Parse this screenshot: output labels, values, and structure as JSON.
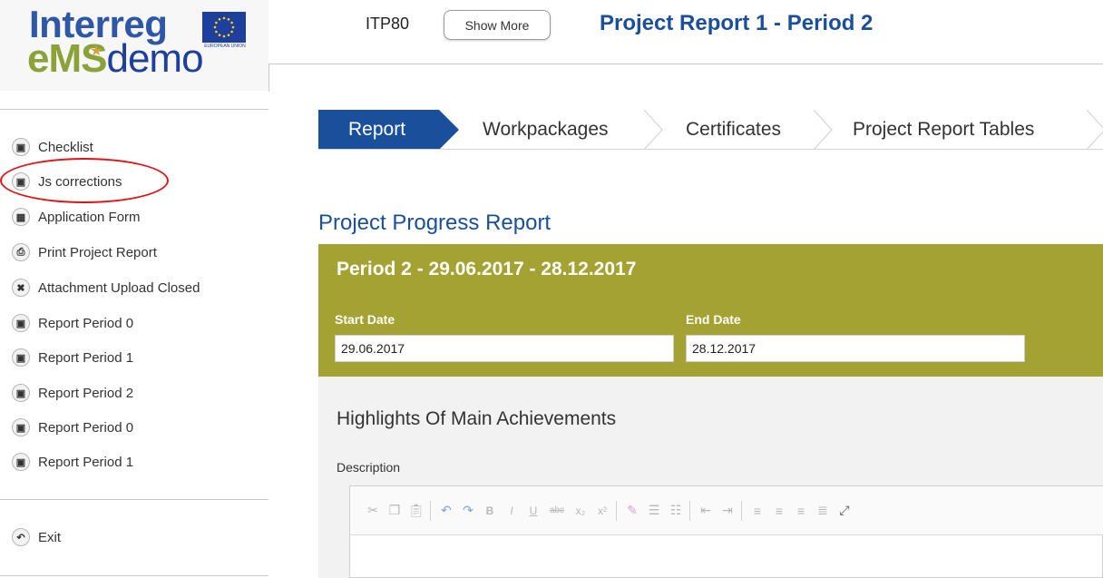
{
  "logo": {
    "line1": "Interreg",
    "line2_ems": "eMS",
    "line2_demo": "demo",
    "eu_caption": "EUROPEAN UNION"
  },
  "header": {
    "project_code": "ITP80",
    "show_more": "Show More",
    "title": "Project Report 1 - Period 2"
  },
  "sidebar": {
    "items": [
      {
        "label": "Checklist",
        "icon": "document-icon"
      },
      {
        "label": "Js corrections",
        "icon": "document-icon"
      },
      {
        "label": "Application Form",
        "icon": "briefcase-icon"
      },
      {
        "label": "Print Project Report",
        "icon": "printer-icon"
      },
      {
        "label": "Attachment Upload Closed",
        "icon": "close-icon"
      },
      {
        "label": "Report Period 0",
        "icon": "document-icon"
      },
      {
        "label": "Report Period 1",
        "icon": "document-icon"
      },
      {
        "label": "Report Period 2",
        "icon": "document-icon"
      },
      {
        "label": "Report Period 0",
        "icon": "document-icon"
      },
      {
        "label": "Report Period 1",
        "icon": "document-icon"
      }
    ],
    "exit": {
      "label": "Exit",
      "icon": "undo-icon"
    },
    "highlighted_item": "Js corrections"
  },
  "tabs": [
    {
      "label": "Report",
      "active": true
    },
    {
      "label": "Workpackages",
      "active": false
    },
    {
      "label": "Certificates",
      "active": false
    },
    {
      "label": "Project Report Tables",
      "active": false
    }
  ],
  "main": {
    "section_title": "Project Progress Report",
    "period": {
      "title": "Period 2 - 29.06.2017 - 28.12.2017",
      "start_label": "Start Date",
      "start_value": "29.06.2017",
      "end_label": "End Date",
      "end_value": "28.12.2017"
    },
    "highlights_title": "Highlights Of Main Achievements",
    "description_label": "Description",
    "editor_toolbar": [
      "cut-icon",
      "copy-icon",
      "paste-icon",
      "undo-icon",
      "redo-icon",
      "bold-icon",
      "italic-icon",
      "underline-icon",
      "strikethrough-icon",
      "subscript-icon",
      "superscript-icon",
      "clear-format-icon",
      "numbered-list-icon",
      "bulleted-list-icon",
      "outdent-icon",
      "indent-icon",
      "align-left-icon",
      "align-center-icon",
      "align-right-icon",
      "justify-icon",
      "maximize-icon"
    ]
  },
  "colors": {
    "primary_blue": "#1a4f9c",
    "olive": "#a3a232",
    "highlight_red": "#e0141b",
    "ems_green": "#8aa238"
  }
}
